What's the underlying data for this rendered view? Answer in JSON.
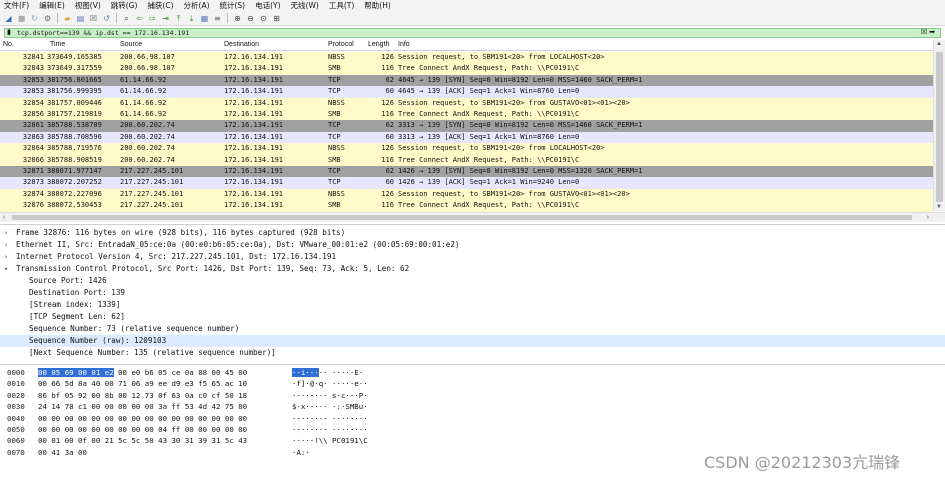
{
  "menu": [
    "文件(F)",
    "编辑(E)",
    "视图(V)",
    "跳转(G)",
    "捕获(C)",
    "分析(A)",
    "统计(S)",
    "电话(Y)",
    "无线(W)",
    "工具(T)",
    "帮助(H)"
  ],
  "toolbar_icons": [
    {
      "name": "shark-fin-icon",
      "glyph": "◢",
      "color": "#3a6fc4"
    },
    {
      "name": "stop-icon",
      "glyph": "■",
      "color": "#b0b0b0"
    },
    {
      "name": "restart-icon",
      "glyph": "↻",
      "color": "#8aa8d8"
    },
    {
      "name": "options-gear-icon",
      "glyph": "⚙",
      "color": "#666"
    },
    {
      "name": "open-folder-icon",
      "glyph": "▰",
      "color": "#e0a53a"
    },
    {
      "name": "save-file-icon",
      "glyph": "▤",
      "color": "#5a7fb8"
    },
    {
      "name": "close-file-icon",
      "glyph": "☒",
      "color": "#666"
    },
    {
      "name": "reload-icon",
      "glyph": "↺",
      "color": "#5a7fb8"
    },
    {
      "name": "find-icon",
      "glyph": "⌕",
      "color": "#444"
    },
    {
      "name": "back-icon",
      "glyph": "⇦",
      "color": "#2e8b2e"
    },
    {
      "name": "forward-icon",
      "glyph": "⇨",
      "color": "#2e8b2e"
    },
    {
      "name": "goto-packet-icon",
      "glyph": "⇥",
      "color": "#2e8b2e"
    },
    {
      "name": "first-packet-icon",
      "glyph": "⤒",
      "color": "#2e8b2e"
    },
    {
      "name": "last-packet-icon",
      "glyph": "⤓",
      "color": "#2e8b2e"
    },
    {
      "name": "autoscroll-icon",
      "glyph": "▦",
      "color": "#5a7fb8"
    },
    {
      "name": "colorize-icon",
      "glyph": "≡",
      "color": "#666"
    },
    {
      "name": "zoom-in-icon",
      "glyph": "⊕",
      "color": "#444"
    },
    {
      "name": "zoom-out-icon",
      "glyph": "⊖",
      "color": "#444"
    },
    {
      "name": "zoom-normal-icon",
      "glyph": "⊙",
      "color": "#444"
    },
    {
      "name": "resize-columns-icon",
      "glyph": "⊞",
      "color": "#444"
    }
  ],
  "filter": {
    "value": "tcp.dstport==139 && ip.dst == 172.16.134.191"
  },
  "columns": {
    "no": "No.",
    "time": "Time",
    "src": "Source",
    "dst": "Destination",
    "proto": "Protocol",
    "len": "Length",
    "info": "Info"
  },
  "colors": {
    "nbss_smb_row": "#fffac8",
    "tcp_row": "#e7e6ff",
    "syn_row": "#a0a0a0",
    "filter_bg": "#c8f0c8",
    "selection": "#2f6fd6"
  },
  "packets": [
    {
      "no": "32841",
      "time": "373649.165385",
      "src": "200.66.98.107",
      "dst": "172.16.134.191",
      "proto": "NBSS",
      "len": "126",
      "info": "Session request, to SBM191<20> from LOCALHOST<20>",
      "kind": "nbss"
    },
    {
      "no": "32843",
      "time": "373649.317559",
      "src": "200.66.98.107",
      "dst": "172.16.134.191",
      "proto": "SMB",
      "len": "116",
      "info": "Tree Connect AndX Request, Path: \\\\PC0191\\C",
      "kind": "nbss"
    },
    {
      "no": "32853",
      "time": "381756.801665",
      "src": "61.14.66.92",
      "dst": "172.16.134.191",
      "proto": "TCP",
      "len": "62",
      "info": "4645 → 139 [SYN] Seq=0 Win=8192 Len=0 MSS=1460 SACK_PERM=1",
      "kind": "syn"
    },
    {
      "no": "32853",
      "time": "381756.999395",
      "src": "61.14.66.92",
      "dst": "172.16.134.191",
      "proto": "TCP",
      "len": "60",
      "info": "4645 → 139 [ACK] Seq=1 Ack=1 Win=8760 Len=0",
      "kind": "tcp"
    },
    {
      "no": "32854",
      "time": "381757.009446",
      "src": "61.14.66.92",
      "dst": "172.16.134.191",
      "proto": "NBSS",
      "len": "126",
      "info": "Session request, to SBM191<20> from GUSTAVO<01><01><20>",
      "kind": "nbss"
    },
    {
      "no": "32856",
      "time": "381757.219819",
      "src": "61.14.66.92",
      "dst": "172.16.134.191",
      "proto": "SMB",
      "len": "116",
      "info": "Tree Connect AndX Request, Path: \\\\PC0191\\C",
      "kind": "nbss"
    },
    {
      "no": "32861",
      "time": "385788.538709",
      "src": "200.60.202.74",
      "dst": "172.16.134.191",
      "proto": "TCP",
      "len": "62",
      "info": "3313 → 139 [SYN] Seq=0 Win=8192 Len=0 MSS=1460 SACK_PERM=1",
      "kind": "syn"
    },
    {
      "no": "32863",
      "time": "385788.708596",
      "src": "200.60.202.74",
      "dst": "172.16.134.191",
      "proto": "TCP",
      "len": "60",
      "info": "3313 → 139 [ACK] Seq=1 Ack=1 Win=8760 Len=0",
      "kind": "tcp"
    },
    {
      "no": "32864",
      "time": "385788.719576",
      "src": "200.60.202.74",
      "dst": "172.16.134.191",
      "proto": "NBSS",
      "len": "126",
      "info": "Session request, to SBM191<20> from LOCALHOST<20>",
      "kind": "nbss"
    },
    {
      "no": "32866",
      "time": "385788.908519",
      "src": "200.60.202.74",
      "dst": "172.16.134.191",
      "proto": "SMB",
      "len": "116",
      "info": "Tree Connect AndX Request, Path: \\\\PC0191\\C",
      "kind": "nbss"
    },
    {
      "no": "32871",
      "time": "388071.977147",
      "src": "217.227.245.101",
      "dst": "172.16.134.191",
      "proto": "TCP",
      "len": "62",
      "info": "1426 → 139 [SYN] Seq=0 Win=8192 Len=0 MSS=1320 SACK_PERM=1",
      "kind": "syn"
    },
    {
      "no": "32873",
      "time": "388072.207252",
      "src": "217.227.245.101",
      "dst": "172.16.134.191",
      "proto": "TCP",
      "len": "60",
      "info": "1426 → 139 [ACK] Seq=1 Ack=1 Win=9240 Len=0",
      "kind": "tcp"
    },
    {
      "no": "32874",
      "time": "388072.227096",
      "src": "217.227.245.101",
      "dst": "172.16.134.191",
      "proto": "NBSS",
      "len": "126",
      "info": "Session request, to SBM191<20> from GUSTAVO<01><01><20>",
      "kind": "nbss"
    },
    {
      "no": "32876",
      "time": "388072.530453",
      "src": "217.227.245.101",
      "dst": "172.16.134.191",
      "proto": "SMB",
      "len": "116",
      "info": "Tree Connect AndX Request, Path: \\\\PC0191\\C",
      "kind": "nbss"
    }
  ],
  "details": [
    {
      "twisty": "›",
      "level": 0,
      "text": "Frame 32876: 116 bytes on wire (928 bits), 116 bytes captured (928 bits)"
    },
    {
      "twisty": "›",
      "level": 0,
      "text": "Ethernet II, Src: EntradaN_05:ce:0a (00:e0:b6:05:ce:0a), Dst: VMware_00:01:e2 (00:05:69:00:01:e2)"
    },
    {
      "twisty": "›",
      "level": 0,
      "text": "Internet Protocol Version 4, Src: 217.227.245.101, Dst: 172.16.134.191"
    },
    {
      "twisty": "⌄",
      "level": 0,
      "text": "Transmission Control Protocol, Src Port: 1426, Dst Port: 139, Seq: 73, Ack: 5, Len: 62"
    },
    {
      "twisty": "",
      "level": 1,
      "text": "Source Port: 1426"
    },
    {
      "twisty": "",
      "level": 1,
      "text": "Destination Port: 139"
    },
    {
      "twisty": "",
      "level": 1,
      "text": "[Stream index: 1339]"
    },
    {
      "twisty": "",
      "level": 1,
      "text": "[TCP Segment Len: 62]"
    },
    {
      "twisty": "",
      "level": 1,
      "text": "Sequence Number: 73    (relative sequence number)"
    },
    {
      "twisty": "",
      "level": 1,
      "text": "Sequence Number (raw): 1209103"
    },
    {
      "twisty": "",
      "level": 1,
      "text": "[Next Sequence Number: 135    (relative sequence number)]"
    }
  ],
  "hex": [
    {
      "off": "0000",
      "hl_hex": "00 05 69 00 01 e2",
      "hex": " 00 e0  b6 05 ce 0a 08 00 45 00",
      "hl_asc": "··i···",
      "asc": "·· ·····E·"
    },
    {
      "off": "0010",
      "hl_hex": "",
      "hex": "00 66 5d 8a 40 00 71 06  a9 ee d9 e3 f5 65 ac 10",
      "hl_asc": "",
      "asc": "·f]·@·q· ·····e··"
    },
    {
      "off": "0020",
      "hl_hex": "",
      "hex": "86 bf 05 92 00 8b 00 12  73 0f 63 0a c0 cf 50 18",
      "hl_asc": "",
      "asc": "········ s·c···P·"
    },
    {
      "off": "0030",
      "hl_hex": "",
      "hex": "24 14 78 c1 00 00 00 00  00 3a ff 53 4d 42 75 00",
      "hl_asc": "",
      "asc": "$·x····· ·:·SMBu·"
    },
    {
      "off": "0040",
      "hl_hex": "",
      "hex": "00 00 00 00 00 00 00 00  00 00 00 00 00 00 00 00",
      "hl_asc": "",
      "asc": "········ ········"
    },
    {
      "off": "0050",
      "hl_hex": "",
      "hex": "00 00 00 00 00 00 00 00  00 04 ff 00 00 00 00 00",
      "hl_asc": "",
      "asc": "········ ········"
    },
    {
      "off": "0060",
      "hl_hex": "",
      "hex": "00 01 00 0f 00 21 5c 5c  50 43 30 31 39 31 5c 43",
      "hl_asc": "",
      "asc": "·····!\\\\ PC0191\\C"
    },
    {
      "off": "0070",
      "hl_hex": "",
      "hex": "00 41 3a 00",
      "hl_asc": "",
      "asc": "·A:·"
    }
  ],
  "watermark": "CSDN @20212303亢瑞锋"
}
